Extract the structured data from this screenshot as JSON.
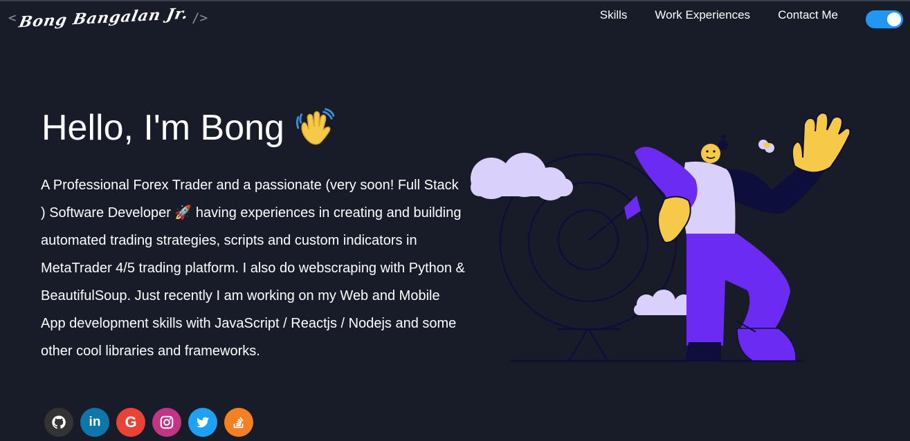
{
  "header": {
    "logo_open": "<",
    "logo_name": "Bong Bangalan Jr.",
    "logo_close": "/>",
    "nav": [
      "Skills",
      "Work Experiences",
      "Contact Me"
    ],
    "theme_toggle_on": true
  },
  "hero": {
    "greeting": "Hello, I'm Bong",
    "bio": "A Professional Forex Trader and a passionate (very soon! Full Stack ) Software Developer 🚀 having experiences in creating and building automated trading strategies, scripts and custom indicators in MetaTrader 4/5 trading platform. I also do webscraping with Python & BeautifulSoup. Just recently I am working on my Web and Mobile App development skills with JavaScript / Reactjs / Nodejs and some other cool libraries and frameworks."
  },
  "social": [
    {
      "name": "github",
      "color": "#333333"
    },
    {
      "name": "linkedin",
      "color": "#0e76a8"
    },
    {
      "name": "google",
      "color": "#ea4335"
    },
    {
      "name": "instagram",
      "color": "#c13584"
    },
    {
      "name": "twitter",
      "color": "#1da1f2"
    },
    {
      "name": "stack-overflow",
      "color": "#f48024"
    }
  ],
  "colors": {
    "background": "#171c28",
    "accent": "#2196f3",
    "purple": "#6c2bf2",
    "lavender": "#d9d0fb",
    "yellow": "#f7c948"
  }
}
